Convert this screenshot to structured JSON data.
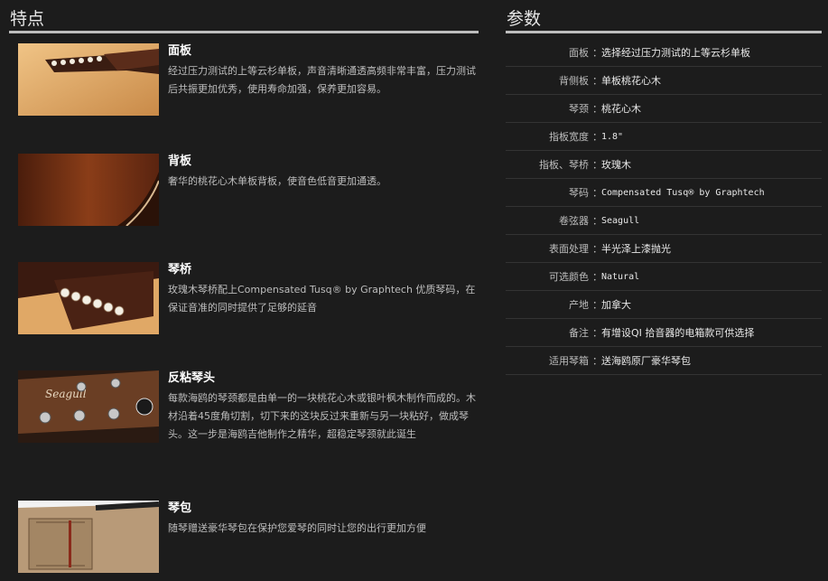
{
  "features": {
    "heading": "特点",
    "items": [
      {
        "title": "面板",
        "desc": "经过压力测试的上等云杉单板，声音清晰通透高频非常丰富，压力测试后共振更加优秀，使用寿命加强，保养更加容易。",
        "image_icon": "guitar-top-bridge-photo"
      },
      {
        "title": "背板",
        "desc": "奢华的桃花心木单板背板，使音色低音更加通透。",
        "image_icon": "mahogany-back-photo"
      },
      {
        "title": "琴桥",
        "desc": "玫瑰木琴桥配上Compensated Tusq® by Graphtech 优质琴码，在保证音准的同时提供了足够的延音",
        "image_icon": "bridge-pins-photo"
      },
      {
        "title": "反粘琴头",
        "desc": "每款海鸥的琴颈都是由单一的一块桃花心木或银叶枫木制作而成的。木材沿着45度角切割，切下来的这块反过来重新与另一块粘好，做成琴头。这一步是海鸥吉他制作之精华，超稳定琴颈就此诞生",
        "image_icon": "headstock-photo",
        "logo_text": "Seagull"
      },
      {
        "title": "琴包",
        "desc": "随琴赠送豪华琴包在保护您爱琴的同时让您的出行更加方便",
        "image_icon": "gig-bag-photo"
      }
    ]
  },
  "specs": {
    "heading": "参数",
    "separator": "：",
    "rows": [
      {
        "key": "面板",
        "value": "选择经过压力测试的上等云杉单板",
        "mono": false
      },
      {
        "key": "背侧板",
        "value": "单板桃花心木",
        "mono": false
      },
      {
        "key": "琴颈",
        "value": "桃花心木",
        "mono": false
      },
      {
        "key": "指板宽度",
        "value": "1.8\"",
        "mono": true
      },
      {
        "key": "指板、琴桥",
        "value": "玫瑰木",
        "mono": false
      },
      {
        "key": "琴码",
        "value": "Compensated Tusq® by Graphtech",
        "mono": true
      },
      {
        "key": "卷弦器",
        "value": "Seagull",
        "mono": true
      },
      {
        "key": "表面处理",
        "value": "半光泽上漆抛光",
        "mono": false
      },
      {
        "key": "可选颜色",
        "value": "Natural",
        "mono": true
      },
      {
        "key": "产地",
        "value": "加拿大",
        "mono": false
      },
      {
        "key": "备注",
        "value": "有增设QI 拾音器的电箱款可供选择",
        "mono": false
      },
      {
        "key": "适用琴箱",
        "value": "送海鸥原厂豪华琴包",
        "mono": false
      }
    ]
  }
}
